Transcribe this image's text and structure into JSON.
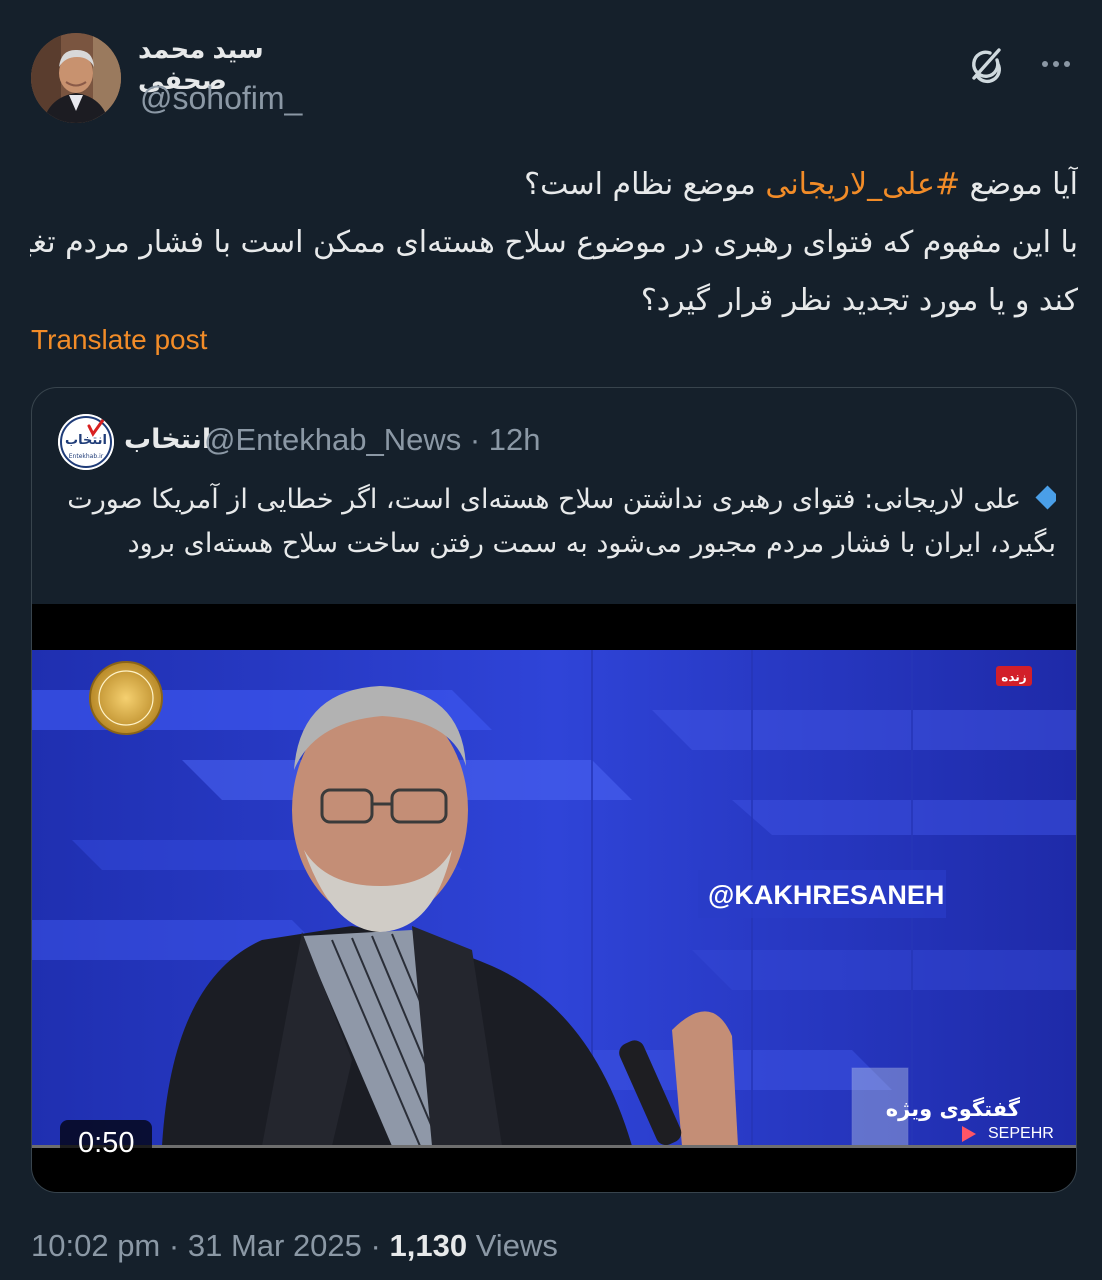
{
  "author": {
    "display_name": "سید محمد صحفی",
    "handle": "@sohofim_"
  },
  "tweet": {
    "line1_prefix": "آیا موضع ",
    "hashtag": "#علی_لاریجانی",
    "line1_suffix": " موضع نظام است؟",
    "line2": "با این مفهوم که فتوای رهبری در موضوع سلاح هسته‌ای ممکن است با فشار مردم تغییر",
    "line3": "کند و یا مورد تجدید نظر قرار گیرد؟",
    "translate_label": "Translate post"
  },
  "quote": {
    "name": "انتخاب",
    "handle": "@Entekhab_News",
    "separator": "·",
    "time": "12h",
    "logo_text": "انتخاب",
    "logo_sub": "Entekhab.ir",
    "line1": "علی لاریجانی: فتوای رهبری نداشتن سلاح هسته‌ای است، اگر خطایی از آمریکا صورت",
    "line2": "بگیرد، ایران با فشار مردم مجبور می‌شود به سمت رفتن ساخت سلاح هسته‌ای برود",
    "video": {
      "duration": "0:50",
      "watermark": "@KAKHRESANEH",
      "live_badge": "زنده",
      "program_title": "گفتگوی ویژه",
      "channel": "SEPEHR"
    }
  },
  "footer": {
    "time": "10:02 pm",
    "dot1": "·",
    "date": "31 Mar 2025",
    "dot2": "·",
    "views_count": "1,130",
    "views_label": "Views"
  },
  "colors": {
    "background": "#15202b",
    "accent": "#f28c28",
    "secondary_text": "#8b98a5",
    "border": "#38444d"
  },
  "icons": {
    "grok": "grok-icon",
    "more": "more-icon",
    "bullet": "diamond-icon"
  }
}
